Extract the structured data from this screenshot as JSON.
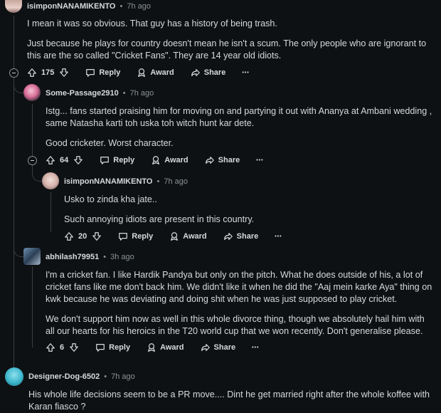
{
  "comments": [
    {
      "author": "isimponNANAMIKENTO",
      "time": "7h ago",
      "paragraphs": [
        "I mean it was so obvious. That guy has a history of being trash.",
        "Just because he plays for country doesn't mean he isn't a scum. The only people who are ignorant to this are the so called \"Cricket Fans\". They are 14 year old idiots."
      ],
      "votes": "175"
    },
    {
      "author": "Some-Passage2910",
      "time": "7h ago",
      "paragraphs": [
        "Istg... fans started praising him for moving on and partying it out with Ananya at Ambani wedding , same Natasha karti toh uska toh witch hunt kar dete.",
        "Good cricketer. Worst character."
      ],
      "votes": "64"
    },
    {
      "author": "isimponNANAMIKENTO",
      "time": "7h ago",
      "paragraphs": [
        "Usko to zinda kha jate..",
        "Such annoying idiots are present in this country."
      ],
      "votes": "20"
    },
    {
      "author": "abhilash79951",
      "time": "3h ago",
      "paragraphs": [
        "I'm a cricket fan. I like Hardik Pandya but only on the pitch. What he does outside of his, a lot of cricket fans like me don't back him. We didn't like it when he did the \"Aaj mein karke Aya\" thing on kwk because he was deviating and doing shit when he was just supposed to play cricket.",
        "We don't support him now as well in this whole divorce thing, though we absolutely hail him with all our hearts for his heroics in the T20 world cup that we won recently. Don't generalise please."
      ],
      "votes": "6"
    },
    {
      "author": "Designer-Dog-6502",
      "time": "7h ago",
      "paragraphs": [
        "His whole life decisions seem to be a PR move.... Dint he get married right after the whole koffee with Karan fiasco ?"
      ]
    }
  ],
  "labels": {
    "separator": "•",
    "reply": "Reply",
    "award": "Award",
    "share": "Share",
    "more": "•••"
  },
  "icons": [
    "upvote-icon",
    "downvote-icon",
    "reply-icon",
    "award-icon",
    "share-icon",
    "more-icon",
    "collapse-icon"
  ],
  "colors": {
    "background": "#0e1113",
    "text": "#d7dadc",
    "meta": "#8b9296",
    "thread_line": "#3a3f42"
  }
}
